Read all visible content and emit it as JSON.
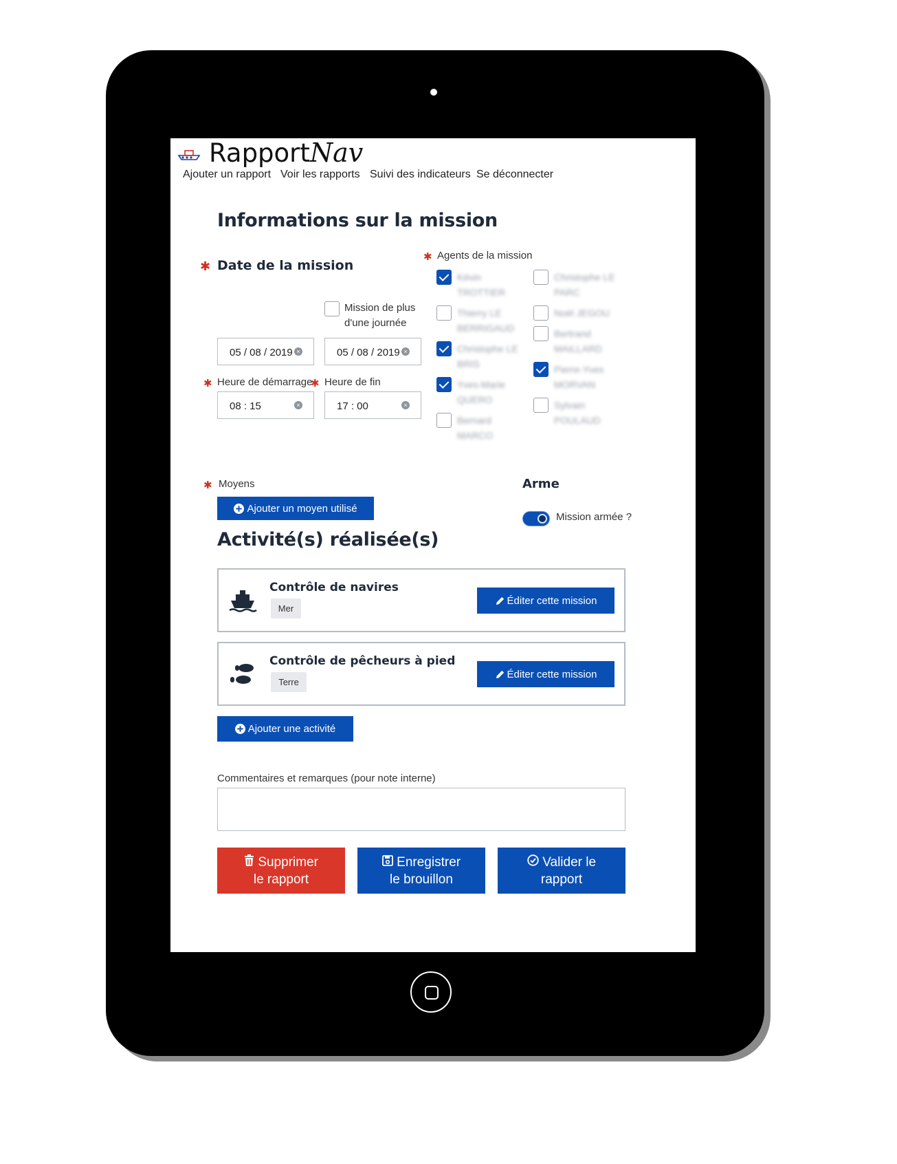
{
  "app": {
    "brand_main": "Rapport",
    "brand_italic": "Nav"
  },
  "nav": [
    "Ajouter un rapport",
    "Voir les rapports",
    "Suivi des indicateurs",
    "Se déconnecter"
  ],
  "mission": {
    "title": "Informations sur la mission",
    "date_label": "Date de la mission",
    "multi_day_label_1": "Mission de plus",
    "multi_day_label_2": "d'une journée",
    "multi_day_checked": false,
    "start_date": "05 / 08 / 2019",
    "end_date": "05 / 08 / 2019",
    "start_time_label": "Heure de démarrage",
    "end_time_label": "Heure de fin",
    "start_time": "08 : 15",
    "end_time": "17 : 00",
    "clear_symbol": "×"
  },
  "agents": {
    "label": "Agents de la mission",
    "list": [
      {
        "l1": "Kévin",
        "l2": "TROTTIER",
        "checked": true
      },
      {
        "l1": "Christophe LE",
        "l2": "PARC",
        "checked": false
      },
      {
        "l1": "Thierry LE",
        "l2": "BERRIGAUD",
        "checked": false
      },
      {
        "l1": "Noël JEGOU",
        "l2": "",
        "checked": false
      },
      {
        "l1": "Bertrand",
        "l2": "MAILLARD",
        "checked": false
      },
      {
        "l1": "Christophe LE",
        "l2": "BRIS",
        "checked": true
      },
      {
        "l1": "Pierre-Yves",
        "l2": "MORVAN",
        "checked": true
      },
      {
        "l1": "Yves-Marie",
        "l2": "QUERO",
        "checked": true
      },
      {
        "l1": "Sylvain",
        "l2": "POULAUD",
        "checked": false
      },
      {
        "l1": "Bernard",
        "l2": "MARCO",
        "checked": false
      }
    ]
  },
  "moyens": {
    "label": "Moyens",
    "add_button": "Ajouter un moyen utilisé"
  },
  "arme": {
    "title": "Arme",
    "toggle_label": "Mission armée ?",
    "toggle_on": true
  },
  "activities": {
    "title": "Activité(s) réalisée(s)",
    "items": [
      {
        "name": "Contrôle de navires",
        "tag": "Mer",
        "icon": "ship-icon",
        "edit": "Éditer cette mission"
      },
      {
        "name": "Contrôle de pêcheurs à pied",
        "tag": "Terre",
        "icon": "footprints-icon",
        "edit": "Éditer cette mission"
      }
    ],
    "add_button": "Ajouter une activité"
  },
  "comments": {
    "label": "Commentaires et remarques (pour note interne)",
    "value": ""
  },
  "actions": {
    "delete_l1": "Supprimer",
    "delete_l2": "le rapport",
    "save_l1": "Enregistrer",
    "save_l2": "le brouillon",
    "validate_l1": "Valider le",
    "validate_l2": "rapport"
  },
  "colors": {
    "primary": "#0a4fb4",
    "danger": "#d9372a",
    "required": "#d0301f"
  }
}
